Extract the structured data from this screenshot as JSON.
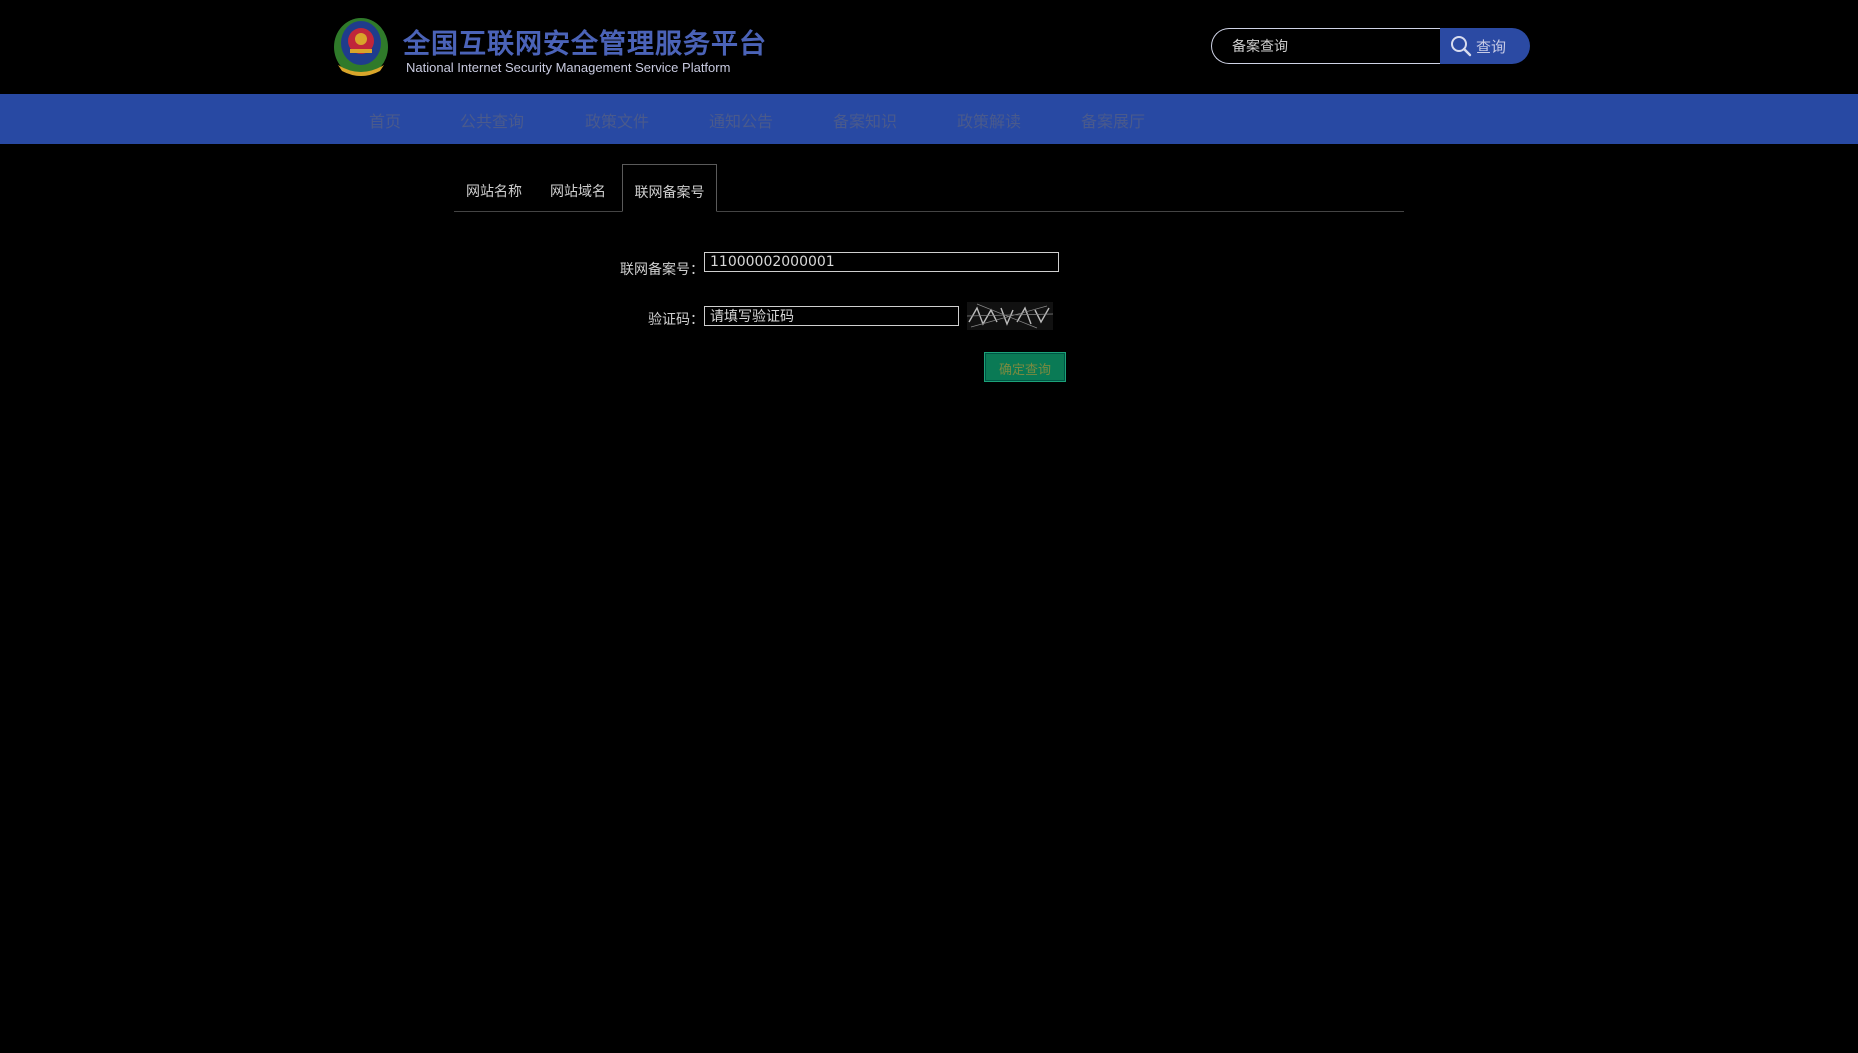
{
  "header": {
    "title_cn": "全国互联网安全管理服务平台",
    "title_en": "National Internet Security Management Service Platform",
    "logo_icon": "police-emblem-icon",
    "search": {
      "value": "备案查询",
      "button_label": "查询",
      "button_icon": "search-icon"
    }
  },
  "nav": {
    "items": [
      {
        "label": "首页"
      },
      {
        "label": "公共查询"
      },
      {
        "label": "政策文件"
      },
      {
        "label": "通知公告"
      },
      {
        "label": "备案知识"
      },
      {
        "label": "政策解读"
      },
      {
        "label": "备案展厅"
      }
    ],
    "background": "#2849a3"
  },
  "tabs": {
    "items": [
      {
        "label": "网站名称"
      },
      {
        "label": "网站域名"
      },
      {
        "label": "联网备案号"
      }
    ],
    "active": "联网备案号"
  },
  "form": {
    "record_label": "联网备案号：",
    "record_value": "11000002000001",
    "captcha_label": "验证码：",
    "captcha_placeholder": "请填写验证码",
    "submit_label": "确定查询"
  },
  "colors": {
    "accent": "#2849a3",
    "submit": "#0a7a55",
    "title": "#4b63b8"
  }
}
